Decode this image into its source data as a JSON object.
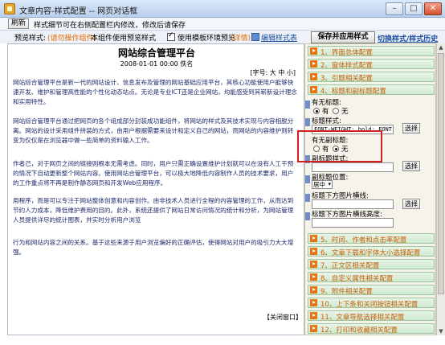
{
  "window": {
    "title": "文章内容-样式配置 -- 网页对话框",
    "btn_min": "–",
    "btn_max": "□",
    "btn_close": "✕"
  },
  "notice": {
    "refresh": "刷新",
    "text": "样式细节可在右侧配置栏内修改，修改后请保存"
  },
  "preview_bar": {
    "label": "预览样式:",
    "style_name": "(请勿操作组件)",
    "desc": "本组件使用预览样式",
    "template_check_label": "使用模板环境预览",
    "detail_link": "(详情)",
    "edit_style": "编辑样式表",
    "save_apply": "保存并应用样式",
    "switch_link": "切换样式/样式历史"
  },
  "article": {
    "title": "网站综合管理平台",
    "meta": "2008-01-01 00:00 佚名",
    "font_size": "[字号: 大 中 小]",
    "paragraphs": [
      "网站综合管理平台是新一代的网站设计、信息发布及管理的网站基础应用平台，其核心功能使用户能够快速开发、维护和管理高性能的个性化动态站点。无论是专业ICT还是企业网站，均能感受到其崭新设计理念和实用特性。",
      "网站综合管理平台通过把网页的各个组成部分封装成功能组件，将网站的样式及其技术实现与内容相脱分离。网站的设计采用组件拼装的方式，由用户根据需要来设计和定义自己的网站，而网站的内容维护则转变为仅仅是在浏览器中做一些简单的资料输入工作。",
      "作者己，对于网页之间的链接则根本无需考虑。同时，用户只需正确设置维护计划就可以在没有人工干预的情况下自动更新整个网站内容。使用网站合管理平台，可以极大地降低内容制作人员的技术要求，用户的工作重点将不再是制作静态网页和开发Web应用程序。",
      "用程序，而是可以专注于网站整体创意和内容创作。由非技术人员进行全程的内容管理的工作，从而达到节约人力成本，降低维护费用的目的。此外，系统还提供了网站日常访问情况的统计和分析，为网站管理人员提供详尽的统计图表，并实时分析用户浏览",
      "行为和网站内容之间的关系。基于这些来源于用户浏览偏好的正确评估，使得网站对用户的吸引力大大增强。"
    ],
    "close_link": "【关闭窗口】"
  },
  "panel": {
    "sections_top": [
      "1、界面总体配置",
      "2、窗体样式配置",
      "3、引题相关配置",
      "4、标题和副标题配置"
    ],
    "has_subtitle_label": "有无标题:",
    "opt_yes": "有",
    "opt_no": "无",
    "title_style_label": "标题样式:",
    "title_style_value": "FONT-WEIGHT: bold; FONT-SIZE:",
    "pick": "选择",
    "has_sub_label": "有无副标题:",
    "sub_style_label": "副标题样式:",
    "sub_pos_label": "副标题位置:",
    "sub_pos_value": "居中",
    "img_bar_label": "标题下方图片横线:",
    "img_bar_height_label": "标题下方图片横线高度:",
    "sections_bottom": [
      "5、时间、作者和点击率配置",
      "6、文章下载和字体大小选择配置",
      "7、正文区相关配置",
      "8、自定义属性相关配置",
      "9、附件相关配置",
      "10、上下条和关闭按钮相关配置",
      "11、文章导航选择相关配置",
      "12、打印和收藏相关配置"
    ]
  }
}
